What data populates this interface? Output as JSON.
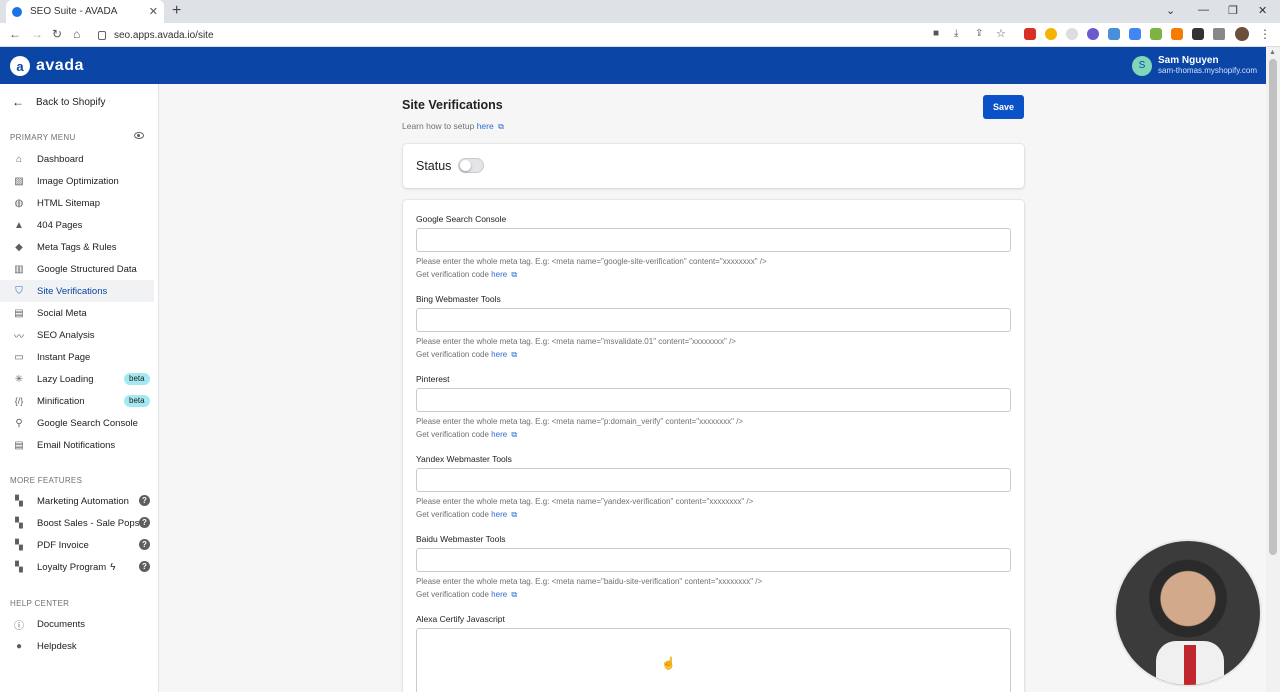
{
  "browser": {
    "tab_title": "SEO Suite - AVADA",
    "url": "seo.apps.avada.io/site"
  },
  "header": {
    "logo_mark": "a",
    "logo_text": "avada",
    "user_initial": "S",
    "user_name": "Sam Nguyen",
    "user_store": "sam-thomas.myshopify.com"
  },
  "sidebar": {
    "back_label": "Back to Shopify",
    "primary_label": "PRIMARY MENU",
    "primary_items": [
      {
        "label": "Dashboard",
        "icon": "home-icon"
      },
      {
        "label": "Image Optimization",
        "icon": "image-icon"
      },
      {
        "label": "HTML Sitemap",
        "icon": "globe-icon"
      },
      {
        "label": "404 Pages",
        "icon": "warning-icon"
      },
      {
        "label": "Meta Tags & Rules",
        "icon": "tag-icon"
      },
      {
        "label": "Google Structured Data",
        "icon": "chart-icon"
      },
      {
        "label": "Site Verifications",
        "icon": "shield-icon"
      },
      {
        "label": "Social Meta",
        "icon": "social-icon"
      },
      {
        "label": "SEO Analysis",
        "icon": "analytics-icon"
      },
      {
        "label": "Instant Page",
        "icon": "page-icon"
      },
      {
        "label": "Lazy Loading",
        "icon": "loading-icon",
        "badge": "beta"
      },
      {
        "label": "Minification",
        "icon": "code-icon",
        "badge": "beta"
      },
      {
        "label": "Google Search Console",
        "icon": "search-icon"
      },
      {
        "label": "Email Notifications",
        "icon": "notification-icon"
      }
    ],
    "more_label": "MORE FEATURES",
    "more_items": [
      {
        "label": "Marketing Automation",
        "icon": "apps-icon"
      },
      {
        "label": "Boost Sales - Sale Pops",
        "icon": "apps-icon"
      },
      {
        "label": "PDF Invoice",
        "icon": "apps-icon"
      },
      {
        "label": "Loyalty Program",
        "icon": "apps-icon"
      }
    ],
    "help_label": "HELP CENTER",
    "help_items": [
      {
        "label": "Documents",
        "icon": "info-icon"
      },
      {
        "label": "Helpdesk",
        "icon": "chat-icon"
      }
    ],
    "question_mark": "?",
    "active": "Site Verifications"
  },
  "main": {
    "title": "Site Verifications",
    "learn_text": "Learn how to setup",
    "learn_link": "here",
    "save_label": "Save",
    "status_label": "Status",
    "status_on": false,
    "get_code_text": "Get verification code",
    "here_link": "here",
    "fields": [
      {
        "label": "Google Search Console",
        "value": "",
        "help": "Please enter the whole meta tag. E.g: <meta name=\"google-site-verification\" content=\"xxxxxxxx\" />"
      },
      {
        "label": "Bing Webmaster Tools",
        "value": "",
        "help": "Please enter the whole meta tag. E.g: <meta name=\"msvalidate.01\" content=\"xxxxxxxx\" />"
      },
      {
        "label": "Pinterest",
        "value": "",
        "help": "Please enter the whole meta tag. E.g: <meta name=\"p:domain_verify\" content=\"xxxxxxxx\" />"
      },
      {
        "label": "Yandex Webmaster Tools",
        "value": "",
        "help": "Please enter the whole meta tag. E.g: <meta name=\"yandex-verification\" content=\"xxxxxxxx\" />"
      },
      {
        "label": "Baidu Webmaster Tools",
        "value": "",
        "help": "Please enter the whole meta tag. E.g: <meta name=\"baidu-site-verification\" content=\"xxxxxxxx\" />"
      }
    ],
    "alexa_label": "Alexa Certify Javascript",
    "alexa_value": ""
  },
  "colors": {
    "brand": "#0b45a6",
    "link": "#2c6ecb",
    "beta_badge": "#a4e8f2"
  }
}
